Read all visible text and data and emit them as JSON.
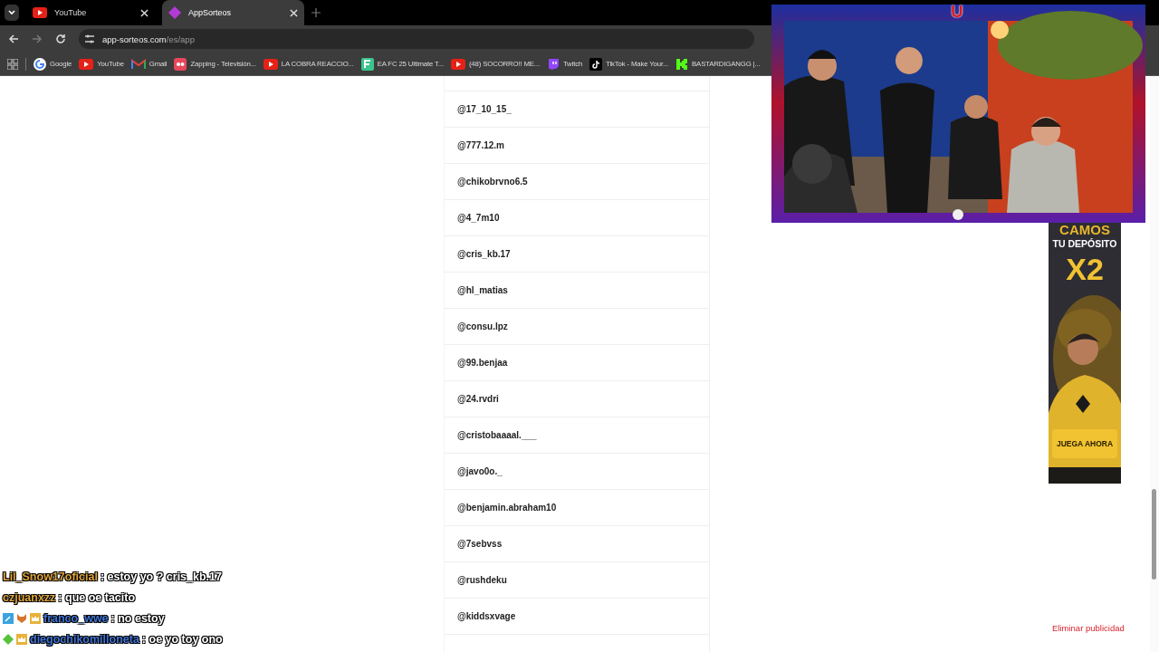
{
  "browser": {
    "tabs": [
      {
        "title": "YouTube",
        "kind": "youtube",
        "selected": false
      },
      {
        "title": "AppSorteos",
        "kind": "appsorteos",
        "selected": true
      }
    ],
    "url": {
      "host": "app-sorteos.com",
      "path": "/es/app"
    },
    "bookmarks": [
      {
        "label": "Google",
        "kind": "google"
      },
      {
        "label": "YouTube",
        "kind": "youtube"
      },
      {
        "label": "Gmail",
        "kind": "gmail"
      },
      {
        "label": "Zapping - Televisión...",
        "kind": "zapping"
      },
      {
        "label": "LA COBRA REACCIO...",
        "kind": "youtube"
      },
      {
        "label": "EA FC 25 Ultimate T...",
        "kind": "fc"
      },
      {
        "label": "(48) SOCORRO!! ME...",
        "kind": "youtube"
      },
      {
        "label": "Twitch",
        "kind": "twitch"
      },
      {
        "label": "TikTok - Make Your...",
        "kind": "tiktok"
      },
      {
        "label": "BASTARDIGANGG |...",
        "kind": "kick"
      }
    ]
  },
  "participants": [
    "@17_10_15_",
    "@777.12.m",
    "@chikobrvno6.5",
    "@4_7m10",
    "@cris_kb.17",
    "@hl_matias",
    "@consu.lpz",
    "@99.benjaa",
    "@24.rvdri",
    "@cristobaaaal.___",
    "@javo0o._",
    "@benjamin.abraham10",
    "@7sebvss",
    "@rushdeku",
    "@kiddsxvage"
  ],
  "ad": {
    "headline": "CAMOS",
    "subtitle": "TU DEPÓSITO",
    "offer": "X2",
    "cta": "JUEGA AHORA"
  },
  "remove_ads_link": "Eliminar publicidad",
  "stream_overlay": {
    "logo": "U"
  },
  "chat": [
    {
      "user": "Lil_Snow17oficial",
      "color": "#e0a43a",
      "message": ": estoy yo ? cris_kb.17"
    },
    {
      "user": "czjuanxzz",
      "color": "#e0a43a",
      "message": ": que oe tacito"
    },
    {
      "user": "franco_wwe",
      "color": "#3f74d6",
      "badges": [
        {
          "kind": "tool"
        },
        {
          "kind": "fox"
        },
        {
          "kind": "crown"
        }
      ],
      "message": ": no estoy"
    },
    {
      "user": "diegochikomilloneta",
      "color": "#3f74d6",
      "badges": [
        {
          "kind": "gem"
        },
        {
          "kind": "crown"
        }
      ],
      "message": ": oe yo toy ono"
    }
  ]
}
